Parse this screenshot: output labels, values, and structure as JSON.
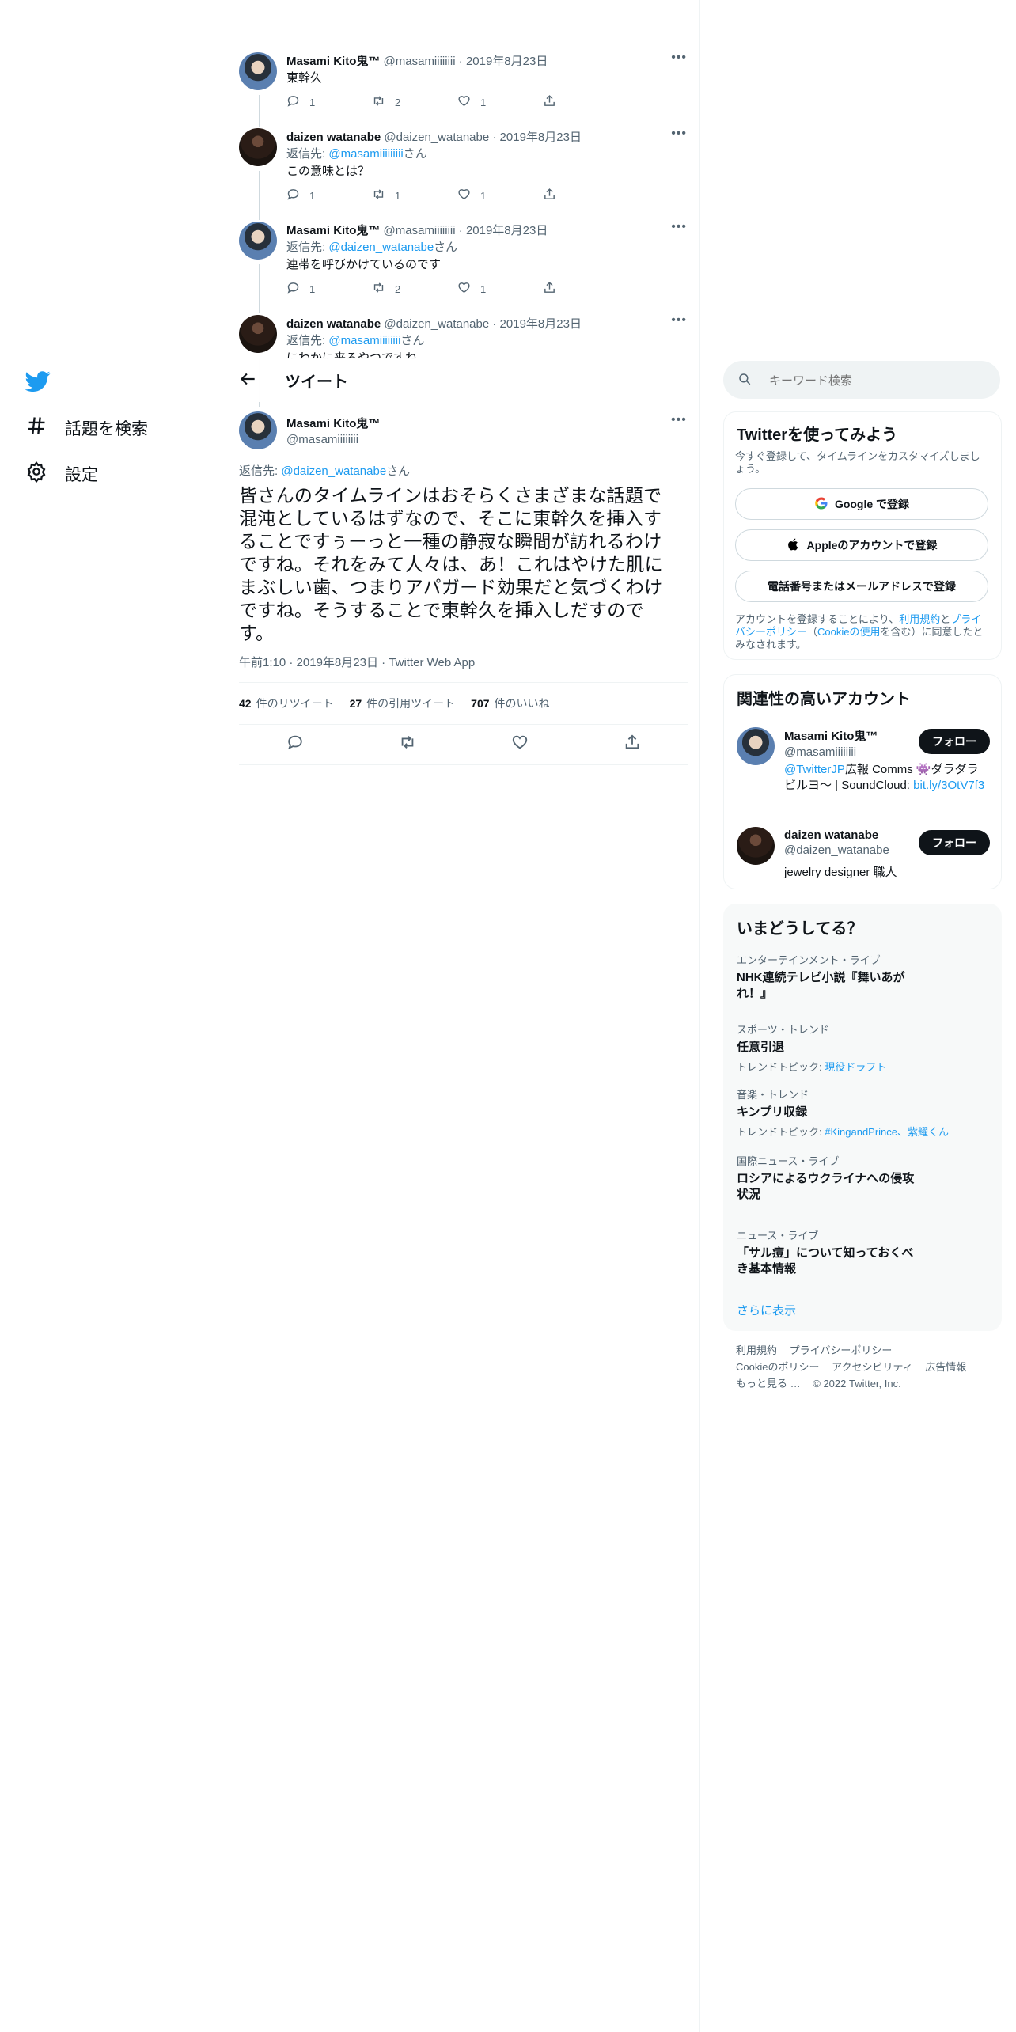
{
  "nav": {
    "explore_label": "話題を検索",
    "settings_label": "設定"
  },
  "thread": [
    {
      "name": "Masami Kito鬼™",
      "handle": "@masamiiiiiiii",
      "date": "2019年8月23日",
      "reply_prefix": "",
      "reply_to": "",
      "reply_suffix": "",
      "text": "東幹久",
      "replies": "1",
      "retweets": "2",
      "likes": "1"
    },
    {
      "name": "daizen watanabe",
      "handle": "@daizen_watanabe",
      "date": "2019年8月23日",
      "reply_prefix": "返信先: ",
      "reply_to": "@masamiiiiiiiii",
      "reply_suffix": "さん",
      "text": "この意味とは？",
      "replies": "1",
      "retweets": "1",
      "likes": "1"
    },
    {
      "name": "Masami Kito鬼™",
      "handle": "@masamiiiiiiii",
      "date": "2019年8月23日",
      "reply_prefix": "返信先: ",
      "reply_to": "@daizen_watanabe",
      "reply_suffix": "さん",
      "text": "連帯を呼びかけているのです",
      "replies": "1",
      "retweets": "2",
      "likes": "1"
    },
    {
      "name": "daizen watanabe",
      "handle": "@daizen_watanabe",
      "date": "2019年8月23日",
      "reply_prefix": "返信先: ",
      "reply_to": "@masamiiiiiiii",
      "reply_suffix": "さん",
      "text": "にわかに来るやつですね"
    }
  ],
  "header": {
    "title": "ツイート"
  },
  "main_tweet": {
    "name": "Masami Kito鬼™",
    "handle": "@masamiiiiiiii",
    "reply_prefix": "返信先: ",
    "reply_to": "@daizen_watanabe",
    "reply_suffix": "さん",
    "text": "皆さんのタイムラインはおそらくさまざまな話題で混沌としているはずなので、そこに東幹久を挿入することですぅーっと一種の静寂な瞬間が訪れるわけですね。それをみて人々は、あ！これはやけた肌にまぶしい歯、つまりアパガード効果だと気づくわけですね。そうすることで東幹久を挿入しだすのです。",
    "time": "午前1:10",
    "date": "2019年8月23日",
    "client": "Twitter Web App",
    "retweet_count": "42",
    "retweet_label": "件のリツイート",
    "quote_count": "27",
    "quote_label": "件の引用ツイート",
    "like_count": "707",
    "like_label": "件のいいね"
  },
  "search": {
    "placeholder": "キーワード検索"
  },
  "signup": {
    "title": "Twitterを使ってみよう",
    "subtitle": "今すぐ登録して、タイムラインをカスタマイズしましょう。",
    "google": "Google で登録",
    "apple": "Appleのアカウントで登録",
    "phone": "電話番号またはメールアドレスで登録",
    "terms_pre": "アカウントを登録することにより、",
    "terms_link": "利用規約",
    "terms_and": "と",
    "privacy_link": "プライバシーポリシー",
    "cookie_open": "（",
    "cookie_link": "Cookieの使用",
    "cookie_close": "を含む）に同意したとみなされます。"
  },
  "related": {
    "title": "関連性の高いアカウント",
    "accounts": [
      {
        "name": "Masami Kito鬼™",
        "handle": "@masamiiiiiiii",
        "bio_link": "@TwitterJP",
        "bio_text": "広報 Comms 👾ダラダラビルヨ〜 | SoundCloud: ",
        "bio_url": "bit.ly/3OtV7f3",
        "follow": "フォロー"
      },
      {
        "name": "daizen watanabe",
        "handle": "@daizen_watanabe",
        "bio_text": "jewelry designer 職人",
        "follow": "フォロー"
      }
    ]
  },
  "trends": {
    "title": "いまどうしてる？",
    "items": [
      {
        "category": "エンターテインメント・ライブ",
        "name": "NHK連続テレビ小説『舞いあがれ！』",
        "sub_label": "",
        "sub_links": ""
      },
      {
        "category": "スポーツ・トレンド",
        "name": "任意引退",
        "sub_label": "トレンドトピック: ",
        "sub_links": "現役ドラフト"
      },
      {
        "category": "音楽・トレンド",
        "name": "キンプリ収録",
        "sub_label": "トレンドトピック: ",
        "sub_links": "#KingandPrince、紫耀くん"
      },
      {
        "category": "国際ニュース・ライブ",
        "name": "ロシアによるウクライナへの侵攻状況",
        "sub_label": "",
        "sub_links": ""
      },
      {
        "category": "ニュース・ライブ",
        "name": "「サル痘」について知っておくべき基本情報",
        "sub_label": "",
        "sub_links": ""
      }
    ],
    "show_more": "さらに表示"
  },
  "footer": {
    "terms": "利用規約",
    "privacy": "プライバシーポリシー",
    "cookie": "Cookieのポリシー",
    "accessibility": "アクセシビリティ",
    "ads": "広告情報",
    "more": "もっと見る …",
    "copyright": "© 2022 Twitter, Inc."
  },
  "colors": {
    "accent": "#1d9bf0",
    "text": "#0f1419",
    "muted": "#536471"
  }
}
